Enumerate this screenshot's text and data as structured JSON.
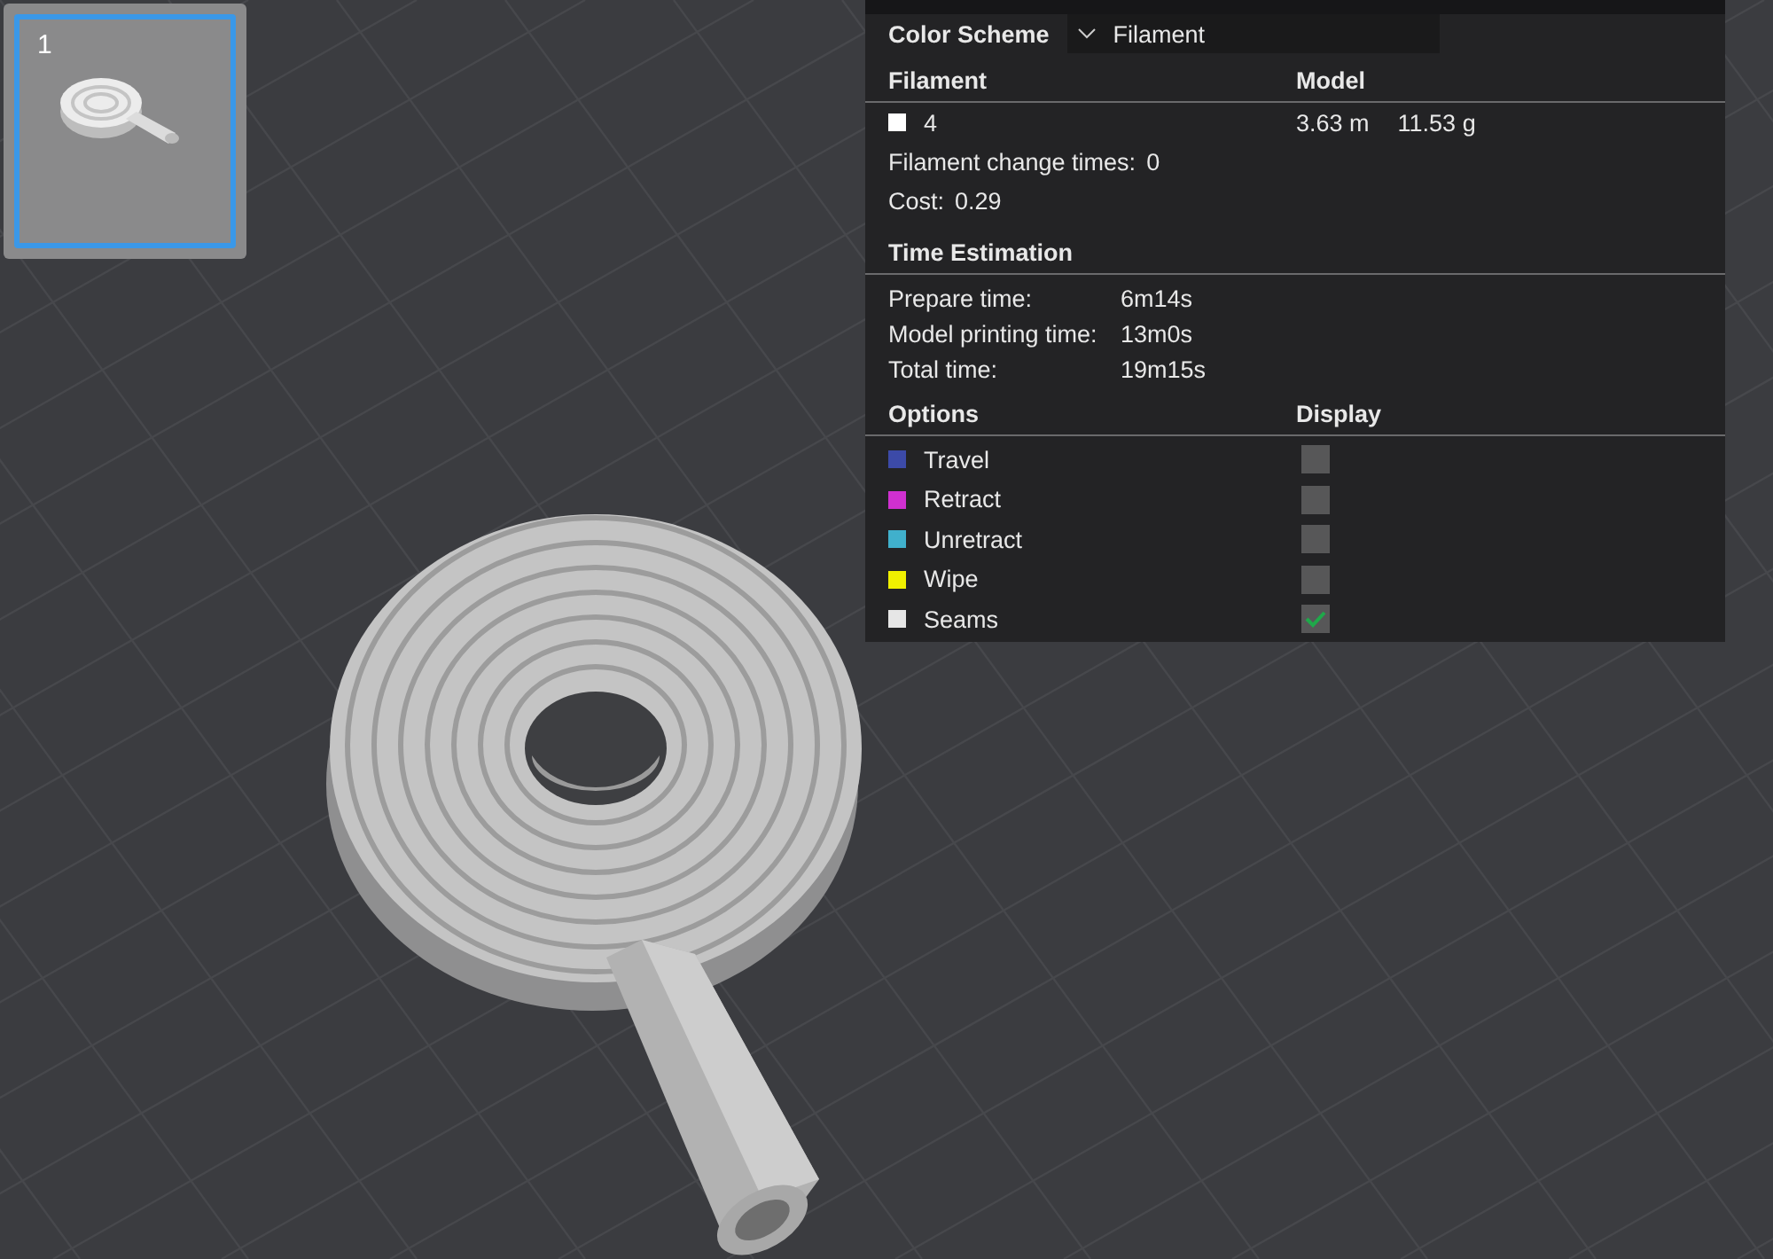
{
  "thumbnails": [
    {
      "label": "1",
      "selected": true
    }
  ],
  "legend": {
    "color_scheme": {
      "label": "Color Scheme",
      "value": "Filament"
    },
    "filament": {
      "headers": [
        "Filament",
        "Model"
      ],
      "rows": [
        {
          "name": "4",
          "color": "#ffffff",
          "length": "3.63 m",
          "weight": "11.53 g"
        }
      ],
      "change_times": {
        "label": "Filament change times:",
        "value": "0"
      },
      "cost": {
        "label": "Cost:",
        "value": "0.29"
      }
    },
    "time": {
      "title": "Time Estimation",
      "rows": [
        {
          "label": "Prepare time:",
          "value": "6m14s"
        },
        {
          "label": "Model printing time:",
          "value": "13m0s"
        },
        {
          "label": "Total time:",
          "value": "19m15s"
        }
      ]
    },
    "options": {
      "headers": [
        "Options",
        "Display"
      ],
      "items": [
        {
          "label": "Travel",
          "color": "#3c4aa8",
          "checked": false
        },
        {
          "label": "Retract",
          "color": "#d030d0",
          "checked": false
        },
        {
          "label": "Unretract",
          "color": "#40b0cc",
          "checked": false
        },
        {
          "label": "Wipe",
          "color": "#f0f000",
          "checked": false
        },
        {
          "label": "Seams",
          "color": "#e6e6e6",
          "checked": true
        }
      ]
    }
  }
}
